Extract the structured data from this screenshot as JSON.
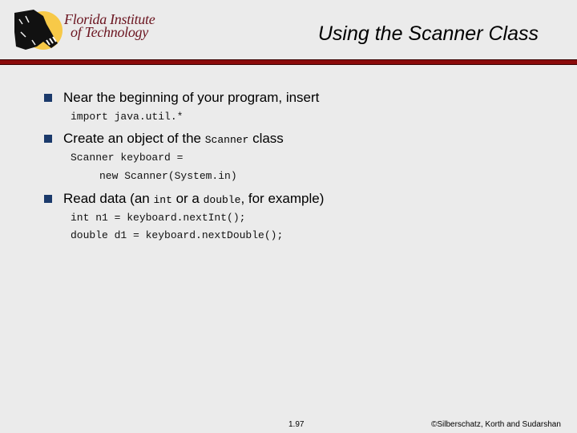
{
  "header": {
    "logo": {
      "line1": "Florida Institute",
      "line2": "of Technology",
      "icon": "panther-logo-icon"
    },
    "title": "Using the Scanner Class",
    "rule_color": "#8b0a0a"
  },
  "bullets": [
    {
      "parts": [
        "Near the beginning of your program, insert"
      ],
      "code": [
        "import java.util.*"
      ]
    },
    {
      "parts": [
        "Create an object of the ",
        "Scanner",
        " class"
      ],
      "code": [
        "Scanner keyboard =",
        "new Scanner(System.in)"
      ]
    },
    {
      "parts": [
        "Read data (an ",
        "int",
        " or a ",
        "double",
        ", for example)"
      ],
      "code": [
        "int n1 = keyboard.nextInt();",
        "double d1 = keyboard.nextDouble();"
      ]
    }
  ],
  "footer": {
    "page": "1.97",
    "copyright": "©Silberschatz, Korth and Sudarshan"
  },
  "colors": {
    "bullet": "#1b3a6b",
    "logo_text": "#6b1520",
    "logo_sun": "#f7c948"
  }
}
